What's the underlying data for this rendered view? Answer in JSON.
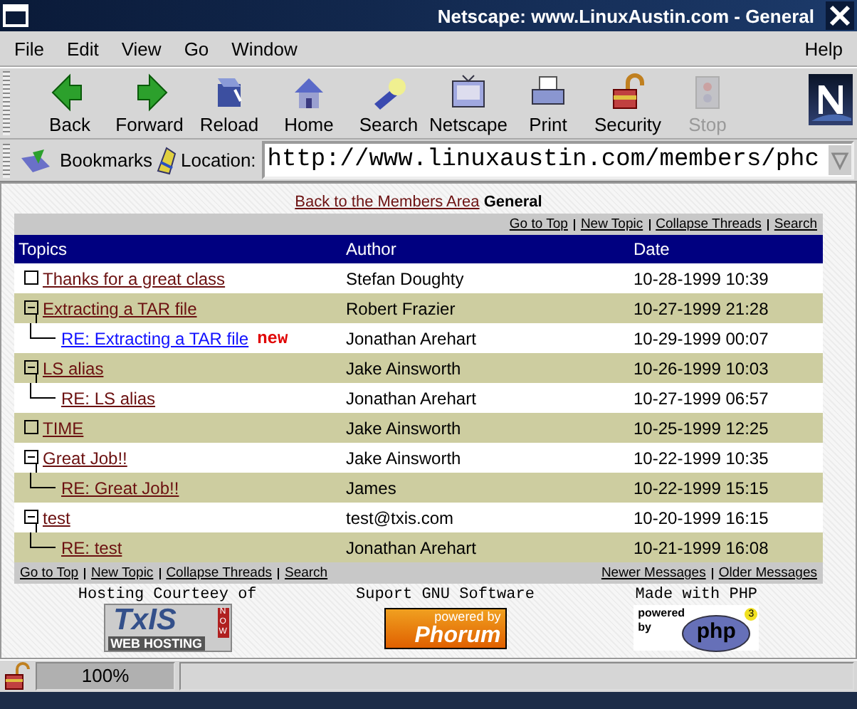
{
  "window": {
    "title": "Netscape: www.LinuxAustin.com - General"
  },
  "menu": [
    {
      "label": "File"
    },
    {
      "label": "Edit"
    },
    {
      "label": "View"
    },
    {
      "label": "Go"
    },
    {
      "label": "Window"
    },
    {
      "label": "Help"
    }
  ],
  "toolbar": [
    {
      "kind": "back",
      "label": "Back",
      "disabled": false
    },
    {
      "kind": "forward",
      "label": "Forward",
      "disabled": false
    },
    {
      "kind": "reload",
      "label": "Reload",
      "disabled": false
    },
    {
      "kind": "home",
      "label": "Home",
      "disabled": false
    },
    {
      "kind": "search",
      "label": "Search",
      "disabled": false
    },
    {
      "kind": "netscape",
      "label": "Netscape",
      "disabled": false
    },
    {
      "kind": "print",
      "label": "Print",
      "disabled": false
    },
    {
      "kind": "security",
      "label": "Security",
      "disabled": false
    },
    {
      "kind": "stop",
      "label": "Stop",
      "disabled": true
    }
  ],
  "location_bar": {
    "bookmarks": "Bookmarks",
    "location_label": "Location:",
    "url": "http://www.linuxaustin.com/members/phc"
  },
  "page": {
    "back_link": "Back to the Members Area",
    "forum": "General",
    "top_nav": [
      "Go to Top",
      "New Topic",
      "Collapse Threads",
      "Search"
    ],
    "columns": [
      "Topics",
      "Author",
      "Date"
    ],
    "topics": [
      {
        "title": "Thanks for a great class",
        "author": "Stefan Doughty",
        "date": "10-28-1999 10:39",
        "visited": true
      },
      {
        "title": "Extracting a TAR file",
        "author": "Robert Frazier",
        "date": "10-27-1999 21:28",
        "visited": true,
        "children": [
          {
            "title": "RE: Extracting a TAR file",
            "badge": "new",
            "author": "Jonathan Arehart",
            "date": "10-29-1999 00:07",
            "visited": false
          }
        ]
      },
      {
        "title": "LS alias",
        "author": "Jake Ainsworth",
        "date": "10-26-1999 10:03",
        "visited": true,
        "children": [
          {
            "title": "RE: LS alias",
            "author": "Jonathan Arehart",
            "date": "10-27-1999 06:57",
            "visited": true
          }
        ]
      },
      {
        "title": "TIME",
        "author": "Jake Ainsworth",
        "date": "10-25-1999 12:25",
        "visited": true
      },
      {
        "title": "Great Job!!",
        "author": "Jake Ainsworth",
        "date": "10-22-1999 10:35",
        "visited": true,
        "children": [
          {
            "title": "RE: Great Job!!",
            "author": "James",
            "date": "10-22-1999 15:15",
            "visited": true
          }
        ]
      },
      {
        "title": "test",
        "author": "test@txis.com",
        "date": "10-20-1999 16:15",
        "visited": true,
        "children": [
          {
            "title": "RE: test",
            "author": "Jonathan Arehart",
            "date": "10-21-1999 16:08",
            "visited": true
          }
        ]
      }
    ],
    "bottom_nav_left": [
      "Go to Top",
      "New Topic",
      "Collapse Threads",
      "Search"
    ],
    "bottom_nav_right": [
      "Newer Messages",
      "Older Messages"
    ],
    "sponsors": [
      {
        "caption": "Hosting Courteey of",
        "kind": "txis",
        "logo_texts": [
          "TxIS",
          "NOW",
          "WEB HOSTING"
        ]
      },
      {
        "caption": "Suport GNU Software",
        "kind": "phorum",
        "logo_texts": [
          "powered by",
          "Phorum"
        ]
      },
      {
        "caption": "Made with PHP",
        "kind": "php",
        "logo_texts": [
          "powered",
          "by",
          "php",
          "3"
        ]
      }
    ]
  },
  "status_bar": {
    "progress": "100%"
  }
}
